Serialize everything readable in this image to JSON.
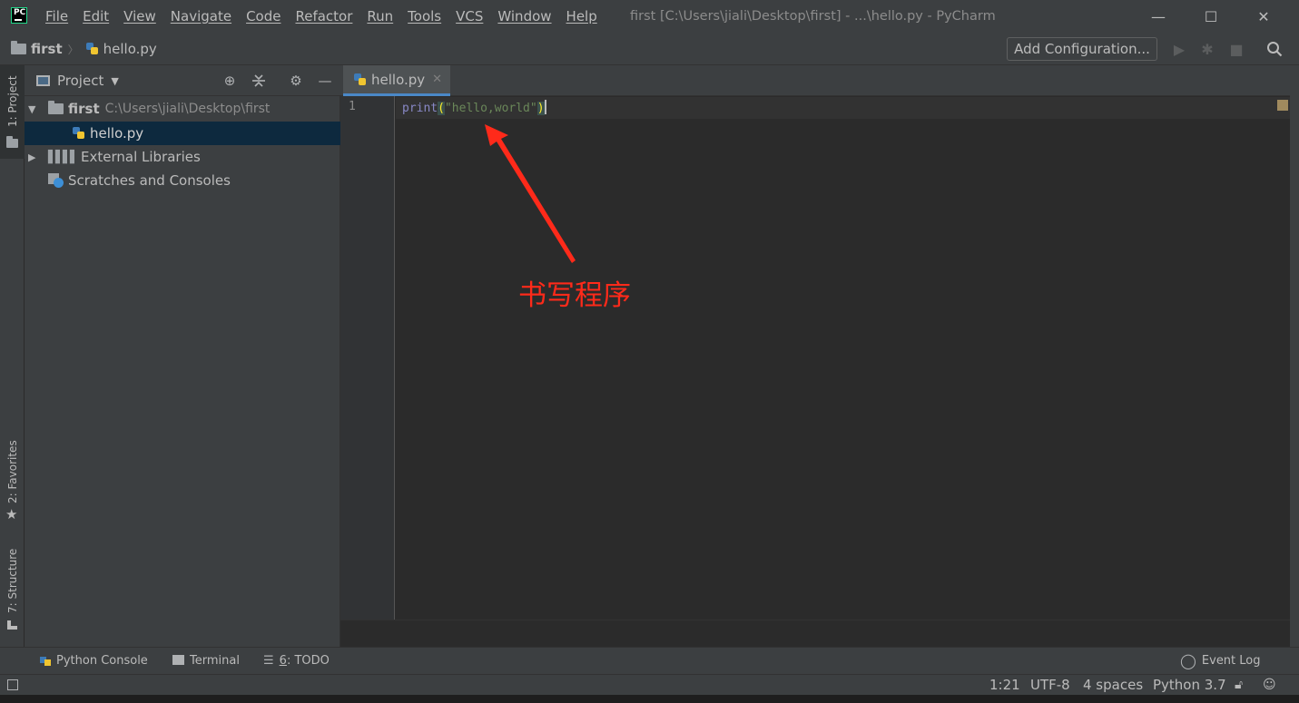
{
  "app": {
    "window_title": "first [C:\\Users\\jiali\\Desktop\\first] - ...\\hello.py - PyCharm",
    "logo_text": "PC",
    "menu": [
      "File",
      "Edit",
      "View",
      "Navigate",
      "Code",
      "Refactor",
      "Run",
      "Tools",
      "VCS",
      "Window",
      "Help"
    ],
    "window_controls": {
      "minimize": "—",
      "maximize": "☐",
      "close": "✕"
    }
  },
  "navbar": {
    "breadcrumbs": [
      "first",
      "hello.py"
    ],
    "add_configuration": "Add Configuration...",
    "icons": [
      "run-icon",
      "debug-icon",
      "stop-icon",
      "search-icon"
    ]
  },
  "left_strip": {
    "project": "1: Project",
    "favorites": "2: Favorites",
    "structure": "7: Structure"
  },
  "project_panel": {
    "title": "Project",
    "tree": [
      {
        "name": "first",
        "path": "C:\\Users\\jiali\\Desktop\\first"
      },
      {
        "name": "hello.py"
      },
      {
        "name": "External Libraries"
      },
      {
        "name": "Scratches and Consoles"
      }
    ]
  },
  "editor": {
    "tab_label": "hello.py",
    "line_numbers": [
      "1"
    ],
    "code": {
      "func": "print",
      "open_paren": "(",
      "string": "\"hello,world\"",
      "close_paren": ")"
    }
  },
  "annotation": {
    "text": "书写程序",
    "color": "#ff2a1a"
  },
  "bottom_tools": {
    "python_console": "Python Console",
    "terminal": "Terminal",
    "todo_prefix": "6",
    "todo": ": TODO",
    "event_log": "Event Log"
  },
  "status": {
    "position": "1:21",
    "encoding": "UTF-8",
    "indent": "4 spaces",
    "interpreter": "Python 3.7"
  },
  "colors": {
    "background": "#2b2b2b",
    "panel": "#3c3f41",
    "selection": "#0d293e",
    "accent": "#4a88c7"
  }
}
